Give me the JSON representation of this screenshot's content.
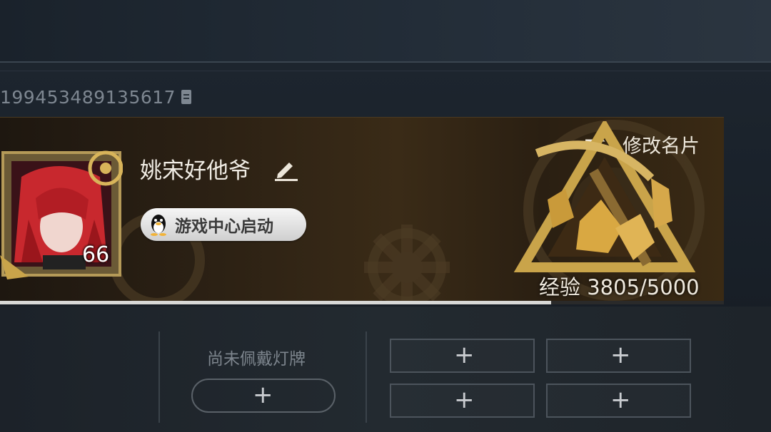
{
  "profile": {
    "uid": "199453489135617",
    "player_name": "姚宋好他爷",
    "level": "66",
    "launch_button_label": "游戏中心启动",
    "modify_card_label": "修改名片",
    "exp_text": "经验 3805/5000",
    "exp_current": 3805,
    "exp_max": 5000
  },
  "badges": {
    "no_badge_text": "尚未佩戴灯牌",
    "add_slots": [
      "+",
      "+",
      "+",
      "+"
    ],
    "add_badge_plus": "+"
  },
  "icons": {
    "copy": "copy-icon",
    "edit": "pencil-icon",
    "qq": "penguin-icon",
    "swap": "swap-icon",
    "emblem": "pickaxe-emblem",
    "avatar": "red-hair-avatar"
  },
  "colors": {
    "accent_gold": "#c9a44a",
    "card_bg": "#2c2114",
    "progress": "#d8d8d6"
  }
}
